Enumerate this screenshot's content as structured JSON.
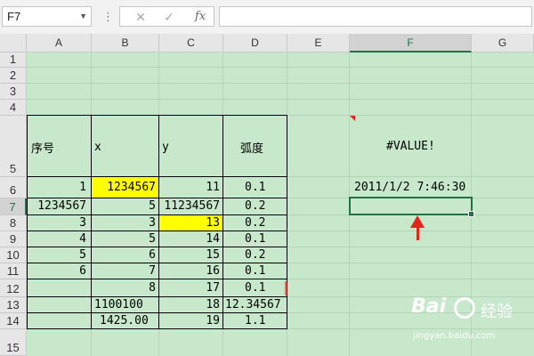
{
  "formula_bar": {
    "name_box": "F7",
    "cancel_icon": "✕",
    "enter_icon": "✓",
    "function_icon": "fx",
    "formula_value": ""
  },
  "columns": [
    "A",
    "B",
    "C",
    "D",
    "E",
    "F",
    "G"
  ],
  "rows": [
    "1",
    "2",
    "3",
    "4",
    "5",
    "6",
    "7",
    "8",
    "9",
    "10",
    "11",
    "12",
    "13",
    "14",
    "15"
  ],
  "selected_cell": "F7",
  "cells": {
    "A5": "序号",
    "B5": "x",
    "C5": "y",
    "D5": "弧度",
    "A6": "1",
    "B6": "1234567",
    "C6": "11",
    "D6": "0.1",
    "A7": "1234567",
    "B7": "5",
    "C7": "11234567",
    "D7": "0.2",
    "A8": "3",
    "B8": "3",
    "C8": "13",
    "D8": "0.2",
    "A9": "4",
    "B9": "5",
    "C9": "14",
    "D9": "0.1",
    "A10": "5",
    "B10": "6",
    "C10": "15",
    "D10": "0.2",
    "A11": "6",
    "B11": "7",
    "C11": "16",
    "D11": "0.1",
    "B12": "8",
    "C12": "17",
    "D12": "0.1",
    "B13": "1100100",
    "C13": "18",
    "D13": "12.34567",
    "B14": "1425.00",
    "C14": "19",
    "D14": "1.1",
    "F5": "#VALUE!",
    "F6": "2011/1/2 7:46:30"
  },
  "highlight_color": "#ffff00",
  "selection_color": "#217346",
  "annotation_arrow_color": "#e0261b",
  "watermark": {
    "brand": "Bai",
    "paw_icon": "paw-icon",
    "suffix": "经验",
    "url": "jingyan.baidu.com"
  }
}
